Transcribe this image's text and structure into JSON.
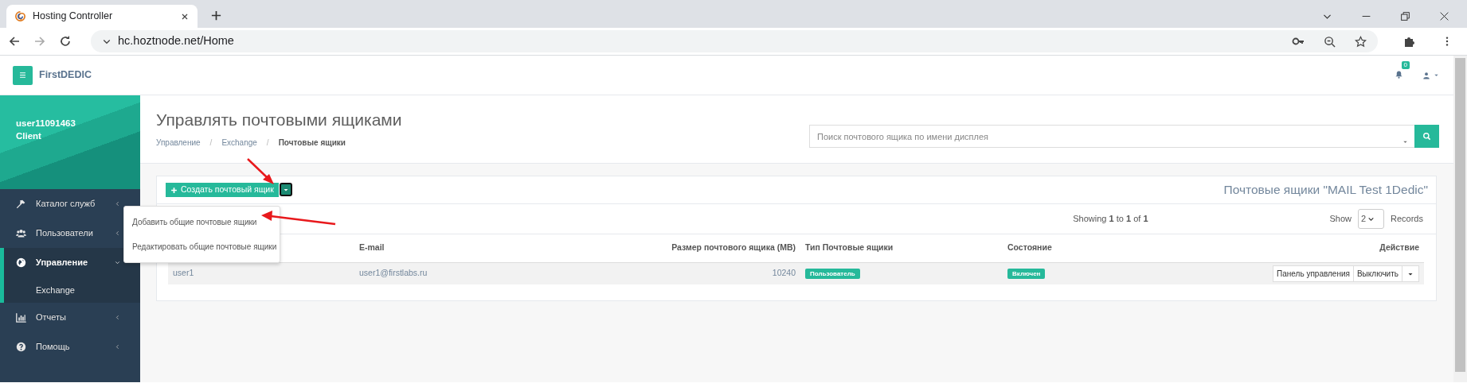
{
  "browser": {
    "tab": {
      "title": "Hosting Controller"
    },
    "url": "hc.hoztnode.net/Home"
  },
  "header": {
    "brand": "FirstDEDIC",
    "notifications": "0"
  },
  "sidebar": {
    "user": "user11091463",
    "role": "Client",
    "items": [
      {
        "label": "Каталог служб",
        "kind": "wrench",
        "selected": false,
        "expanded": false
      },
      {
        "label": "Пользователи",
        "kind": "users",
        "selected": false,
        "expanded": false
      },
      {
        "label": "Управление",
        "kind": "globe",
        "selected": true,
        "expanded": true,
        "children": [
          {
            "label": "Exchange"
          }
        ]
      },
      {
        "label": "Отчеты",
        "kind": "chart",
        "selected": false,
        "expanded": false
      },
      {
        "label": "Помощь",
        "kind": "question",
        "selected": false,
        "expanded": false
      }
    ]
  },
  "page": {
    "title": "Управлять почтовыми ящиками",
    "breadcrumb_separator": "/",
    "breadcrumb": [
      {
        "label": "Управление",
        "selected": false
      },
      {
        "label": "Exchange",
        "selected": false
      },
      {
        "label": "Почтовые ящики",
        "selected": true
      }
    ],
    "search": {
      "placeholder": "Поиск почтового ящика по имени дисплея"
    }
  },
  "panel": {
    "create_button": "Создать почтовый ящик",
    "menu": {
      "expanded": true,
      "items": [
        "Добавить общие почтовые ящики",
        "Редактировать общие почтовые ящики"
      ]
    },
    "title": "Почтовые ящики \"MAIL Test 1Dedic\"",
    "showing": "Showing **1** to **1** of **1**",
    "page_size": {
      "label": "Show",
      "value": "2",
      "suffix": "Records"
    }
  },
  "table": {
    "columns": [
      "E-mail",
      "Размер почтового ящика (MB)",
      "Тип Почтовые ящики",
      "Состояние",
      "Действие"
    ],
    "rows": [
      {
        "name": "user1",
        "email": "user1@firstlabs.ru",
        "size": "10240",
        "type": "Пользователь",
        "status": "Включен",
        "actions": [
          "Панель управления",
          "Выключить"
        ]
      }
    ]
  }
}
